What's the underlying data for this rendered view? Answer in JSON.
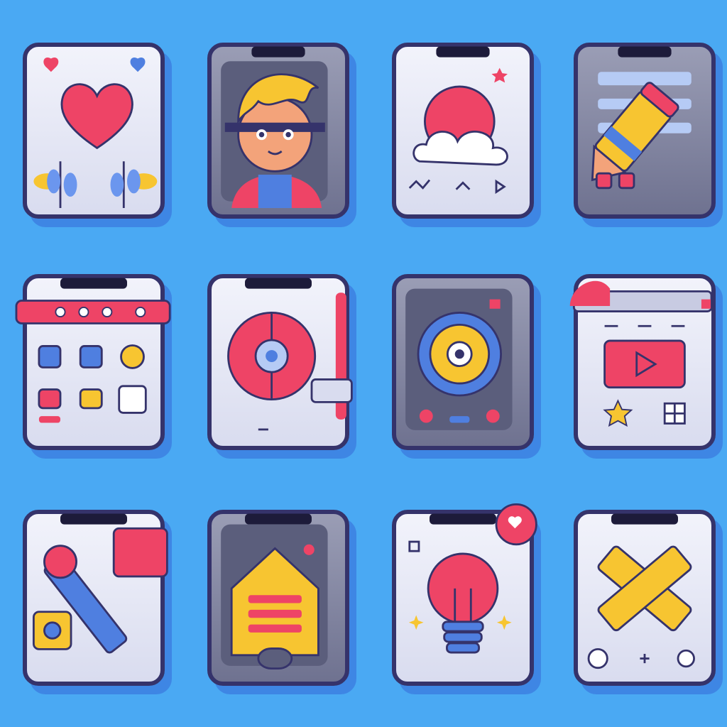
{
  "colors": {
    "background": "#4aa9f3",
    "outline": "#35336b",
    "pink": "#ee4466",
    "yellow": "#f7c531",
    "blue": "#4f7fe0",
    "card_light": "#eceef8",
    "card_dark": "#7d809c"
  },
  "grid": {
    "rows": 3,
    "columns": 4,
    "count": 12
  },
  "cards": [
    {
      "icon": "heart-icon",
      "style": "light"
    },
    {
      "icon": "avatar-boy-icon",
      "style": "dark"
    },
    {
      "icon": "gear-cloud-icon",
      "style": "light"
    },
    {
      "icon": "pencil-icon",
      "style": "dark"
    },
    {
      "icon": "calendar-grid-icon",
      "style": "light"
    },
    {
      "icon": "record-disc-icon",
      "style": "light"
    },
    {
      "icon": "camera-lens-icon",
      "style": "dark"
    },
    {
      "icon": "video-play-icon",
      "style": "light"
    },
    {
      "icon": "brush-icon",
      "style": "light"
    },
    {
      "icon": "house-icon",
      "style": "dark"
    },
    {
      "icon": "lightbulb-icon",
      "style": "light"
    },
    {
      "icon": "cross-tools-icon",
      "style": "light"
    }
  ]
}
